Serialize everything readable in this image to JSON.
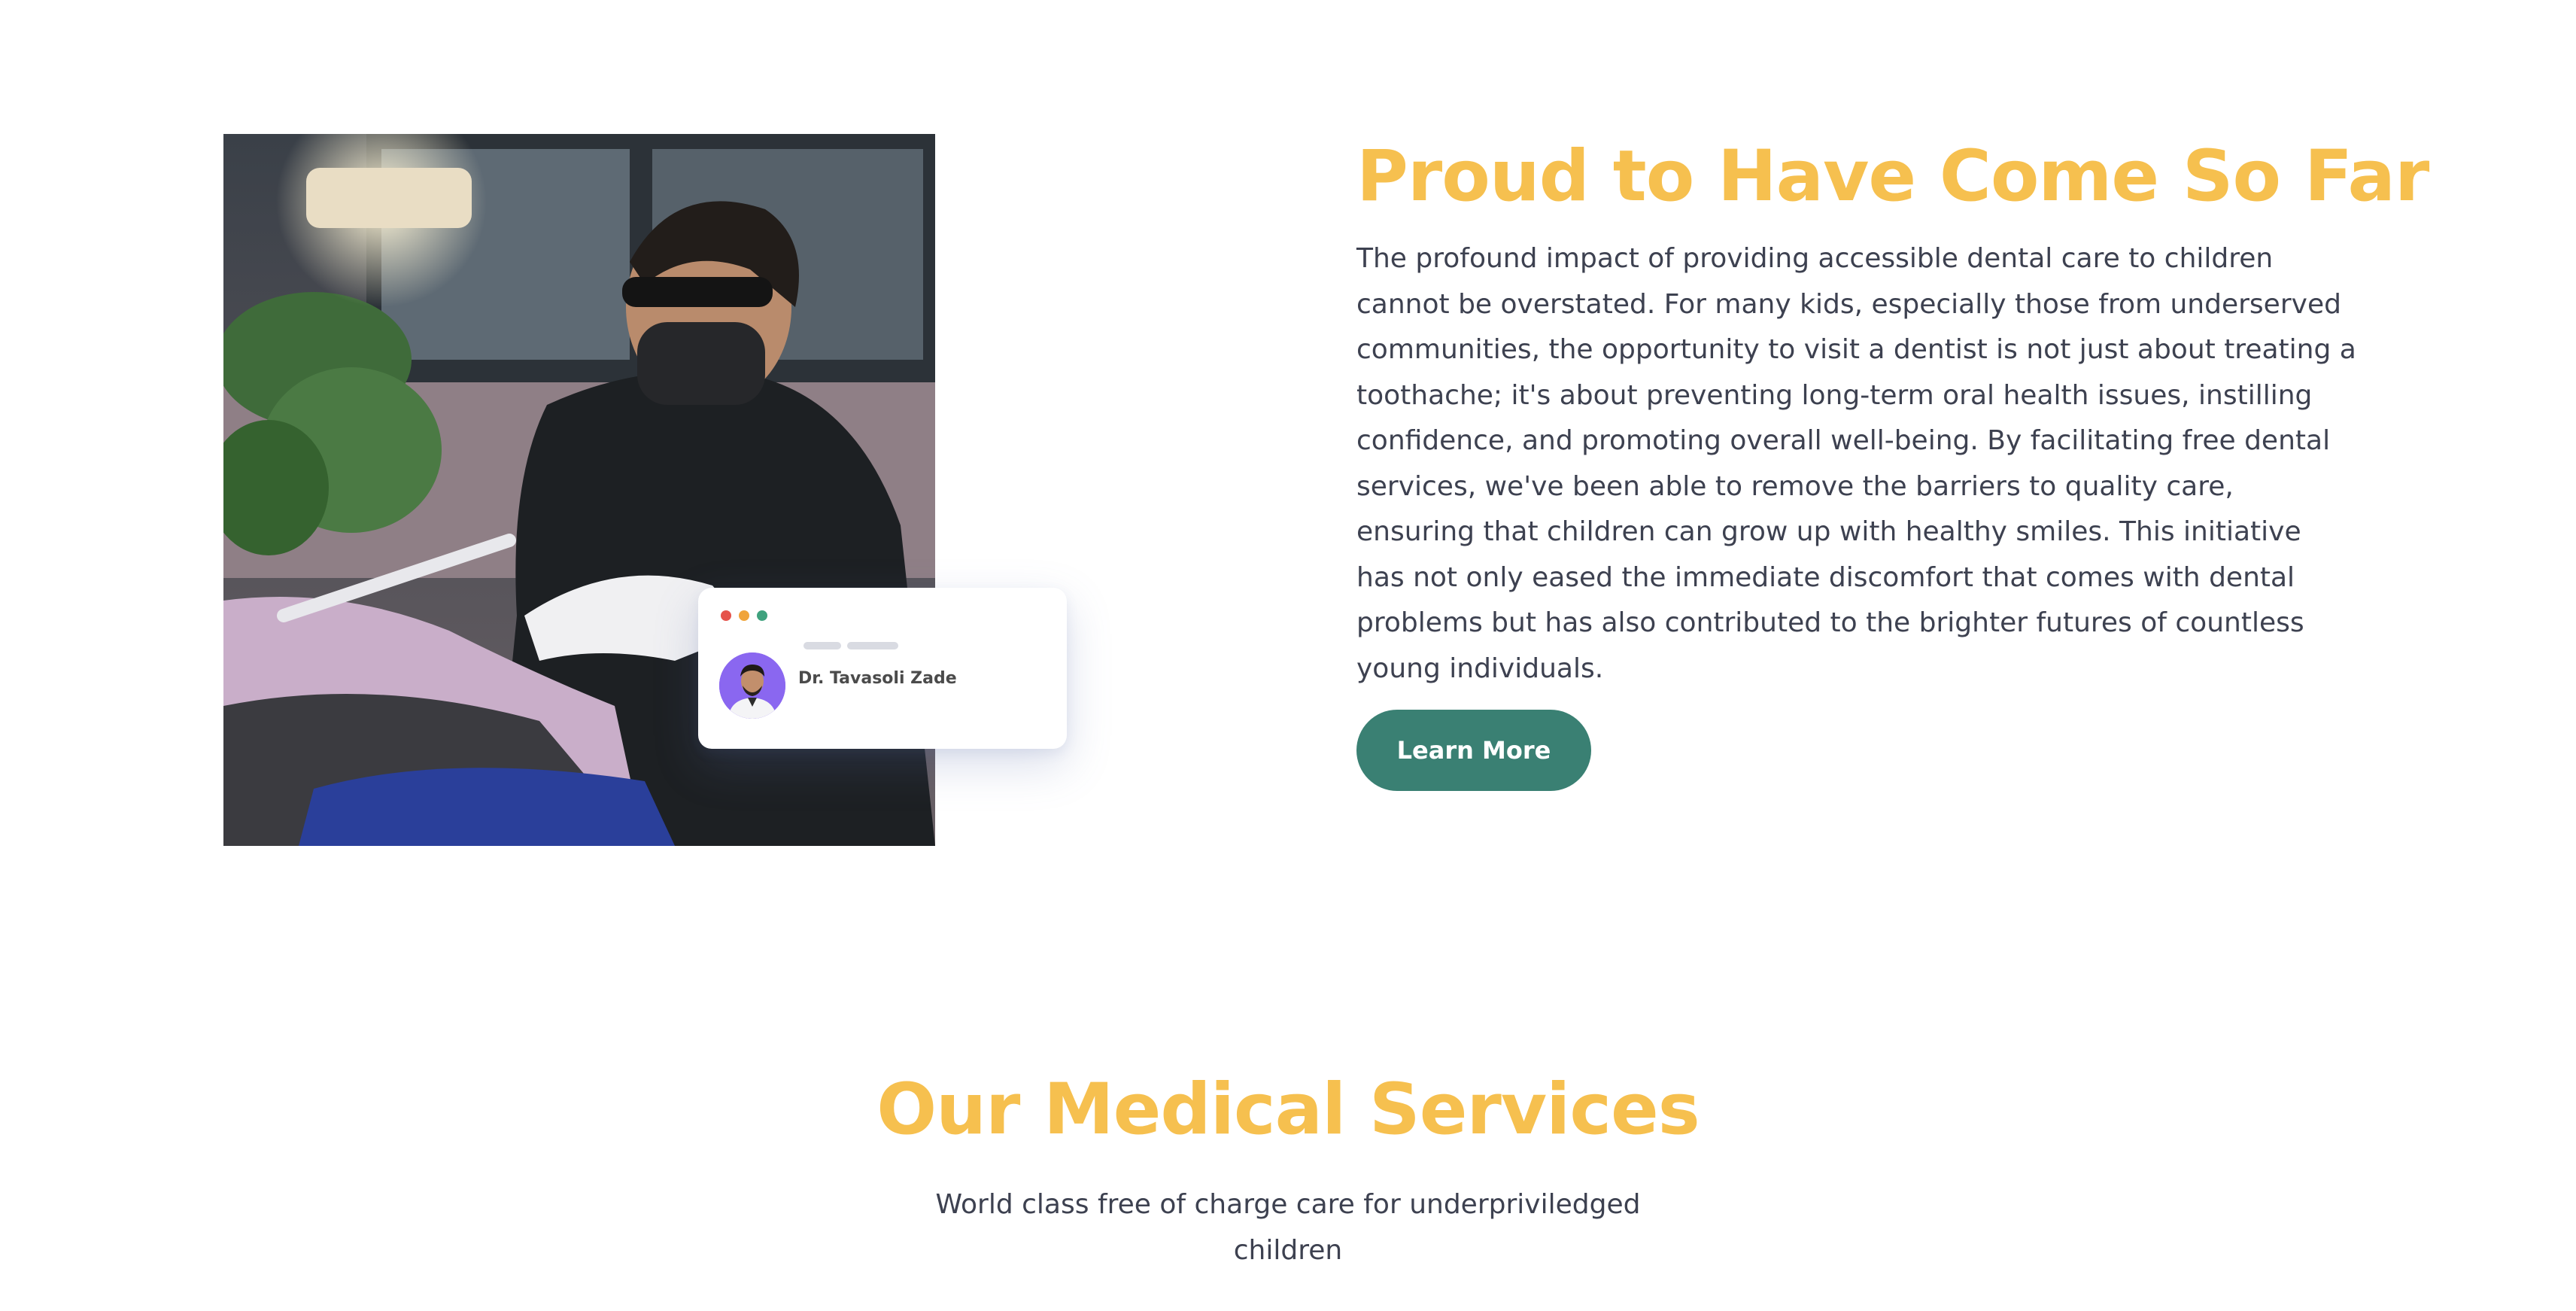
{
  "about": {
    "title": "Proud to Have Come So Far",
    "body": "The profound impact of providing accessible dental care to children cannot be overstated. For many kids, especially those from underserved communities, the opportunity to visit a dentist is not just about treating a toothache; it's about preventing long-term oral health issues, instilling confidence, and promoting overall well-being. By facilitating free dental services, we've been able to remove the barriers to quality care, ensuring that children can grow up with healthy smiles. This initiative has not only eased the immediate discomfort that comes with dental problems but has also contributed to the brighter futures of countless young individuals.",
    "button_label": "Learn More",
    "photo_icon": "dentist-treating-patient-photo"
  },
  "doctor_card": {
    "name": "Dr. Tavasoli Zade",
    "window_dots": [
      "#e5534b",
      "#f0a43a",
      "#3fa27e"
    ],
    "avatar_icon": "doctor-avatar"
  },
  "services": {
    "title": "Our Medical Services",
    "subtitle": "World class free of charge care for underpriviledged children"
  },
  "colors": {
    "heading": "#f6c04f",
    "body_text": "#3d4150",
    "button": "#3a8073",
    "avatar_bg": "#8a67f0"
  }
}
